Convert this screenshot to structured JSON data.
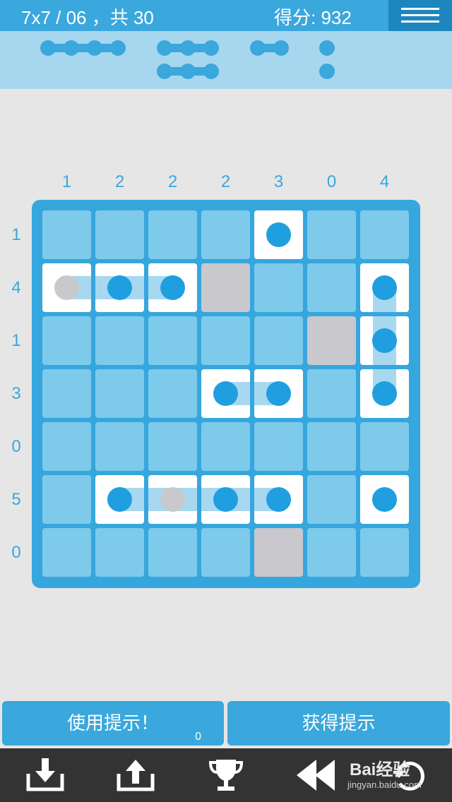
{
  "header": {
    "level_text": "7x7 / 06 ，共 30",
    "score_text": "得分: 932"
  },
  "fleet": [
    {
      "size": 4,
      "count": 1
    },
    {
      "size": 3,
      "count": 2
    },
    {
      "size": 2,
      "count": 1
    },
    {
      "size": 1,
      "count": 2
    }
  ],
  "column_clues": [
    "1",
    "2",
    "2",
    "2",
    "3",
    "0",
    "4"
  ],
  "row_clues": [
    "1",
    "4",
    "1",
    "3",
    "0",
    "5",
    "0"
  ],
  "board": {
    "size": 7,
    "cells": [
      {
        "r": 0,
        "c": 4,
        "state": "ship",
        "dot": "blue"
      },
      {
        "r": 1,
        "c": 0,
        "state": "ship",
        "dot": "grey",
        "band": "right"
      },
      {
        "r": 1,
        "c": 1,
        "state": "ship",
        "dot": "blue",
        "band": "both"
      },
      {
        "r": 1,
        "c": 2,
        "state": "ship",
        "dot": "blue",
        "band": "left"
      },
      {
        "r": 1,
        "c": 3,
        "state": "blocked"
      },
      {
        "r": 1,
        "c": 6,
        "state": "ship",
        "dot": "blue",
        "band": "down"
      },
      {
        "r": 2,
        "c": 5,
        "state": "blocked"
      },
      {
        "r": 2,
        "c": 6,
        "state": "ship",
        "dot": "blue",
        "band": "vert"
      },
      {
        "r": 3,
        "c": 3,
        "state": "ship",
        "dot": "blue",
        "band": "right"
      },
      {
        "r": 3,
        "c": 4,
        "state": "ship",
        "dot": "blue",
        "band": "left"
      },
      {
        "r": 3,
        "c": 6,
        "state": "ship",
        "dot": "blue",
        "band": "up"
      },
      {
        "r": 5,
        "c": 1,
        "state": "ship",
        "dot": "blue",
        "band": "right"
      },
      {
        "r": 5,
        "c": 2,
        "state": "ship",
        "dot": "grey",
        "band": "both"
      },
      {
        "r": 5,
        "c": 3,
        "state": "ship",
        "dot": "blue",
        "band": "both"
      },
      {
        "r": 5,
        "c": 4,
        "state": "ship",
        "dot": "blue",
        "band": "left"
      },
      {
        "r": 5,
        "c": 6,
        "state": "ship",
        "dot": "blue"
      },
      {
        "r": 6,
        "c": 4,
        "state": "blocked"
      }
    ]
  },
  "buttons": {
    "use_hint_label": "使用提示！",
    "hint_count": "0",
    "get_hint_label": "获得提示"
  },
  "toolbar": {
    "icons": [
      "download-icon",
      "upload-icon",
      "trophy-icon",
      "rewind-icon",
      "undo-icon"
    ]
  },
  "watermark": {
    "brand": "Bai经验",
    "url": "jingyan.baidu.com"
  },
  "colors": {
    "primary": "#3aa7dd",
    "dark": "#1d86bf",
    "light_panel": "#a6d7ee",
    "cell": "#7ecaeb",
    "blocked": "#c9c8cd",
    "ship_cell": "#ffffff",
    "toolbar": "#333333"
  }
}
